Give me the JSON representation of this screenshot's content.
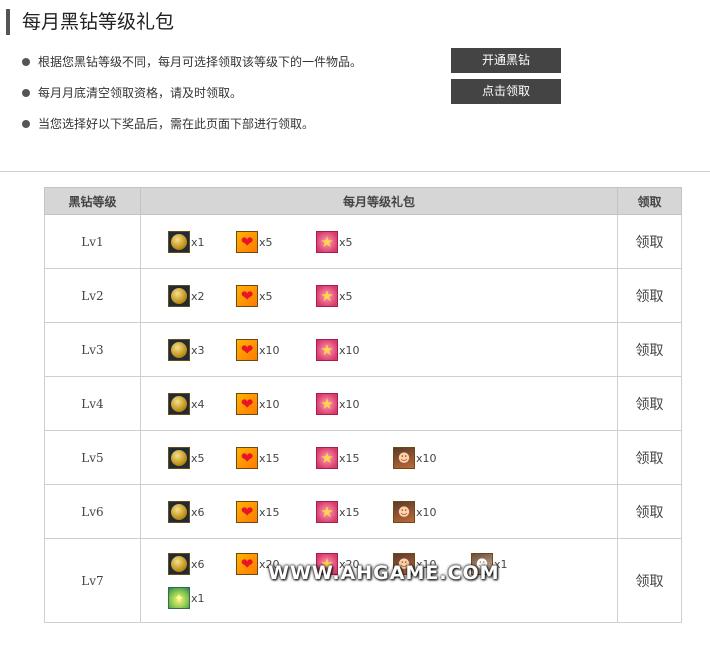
{
  "page_title": "每月黑钻等级礼包",
  "notes": [
    "根据您黑钻等级不同，每月可选择领取该等级下的一件物品。",
    "每月月底清空领取资格，请及时领取。",
    "当您选择好以下奖品后，需在此页面下部进行领取。"
  ],
  "buttons": {
    "open_vip": "开通黑钻",
    "claim": "点击领取"
  },
  "table": {
    "headers": {
      "level": "黑钻等级",
      "gift": "每月等级礼包",
      "claim": "领取"
    },
    "claim_label": "领取",
    "rows": [
      {
        "level": "Lv1",
        "items": [
          {
            "icon": "coin-icon",
            "qty": "x1"
          },
          {
            "icon": "heart-icon",
            "qty": "x5"
          },
          {
            "icon": "star-icon",
            "qty": "x5"
          }
        ]
      },
      {
        "level": "Lv2",
        "items": [
          {
            "icon": "coin-icon",
            "qty": "x2"
          },
          {
            "icon": "heart-icon",
            "qty": "x5"
          },
          {
            "icon": "star-icon",
            "qty": "x5"
          }
        ]
      },
      {
        "level": "Lv3",
        "items": [
          {
            "icon": "coin-icon",
            "qty": "x3"
          },
          {
            "icon": "heart-icon",
            "qty": "x10"
          },
          {
            "icon": "star-icon",
            "qty": "x10"
          }
        ]
      },
      {
        "level": "Lv4",
        "items": [
          {
            "icon": "coin-icon",
            "qty": "x4"
          },
          {
            "icon": "heart-icon",
            "qty": "x10"
          },
          {
            "icon": "star-icon",
            "qty": "x10"
          }
        ]
      },
      {
        "level": "Lv5",
        "items": [
          {
            "icon": "coin-icon",
            "qty": "x5"
          },
          {
            "icon": "heart-icon",
            "qty": "x15"
          },
          {
            "icon": "star-icon",
            "qty": "x15"
          },
          {
            "icon": "hero-portrait-icon",
            "qty": "x10"
          }
        ]
      },
      {
        "level": "Lv6",
        "items": [
          {
            "icon": "coin-icon",
            "qty": "x6"
          },
          {
            "icon": "heart-icon",
            "qty": "x15"
          },
          {
            "icon": "star-icon",
            "qty": "x15"
          },
          {
            "icon": "hero-portrait-icon",
            "qty": "x10"
          }
        ]
      },
      {
        "level": "Lv7",
        "items": [
          {
            "icon": "coin-icon",
            "qty": "x6"
          },
          {
            "icon": "heart-icon",
            "qty": "x20"
          },
          {
            "icon": "star-icon",
            "qty": "x20"
          },
          {
            "icon": "hero-portrait-icon",
            "qty": "x10"
          },
          {
            "icon": "warrior-portrait-icon",
            "qty": "x1"
          },
          {
            "icon": "flame-icon",
            "qty": "x1"
          }
        ]
      }
    ]
  },
  "watermark": "WWW.AHGAME.COM"
}
